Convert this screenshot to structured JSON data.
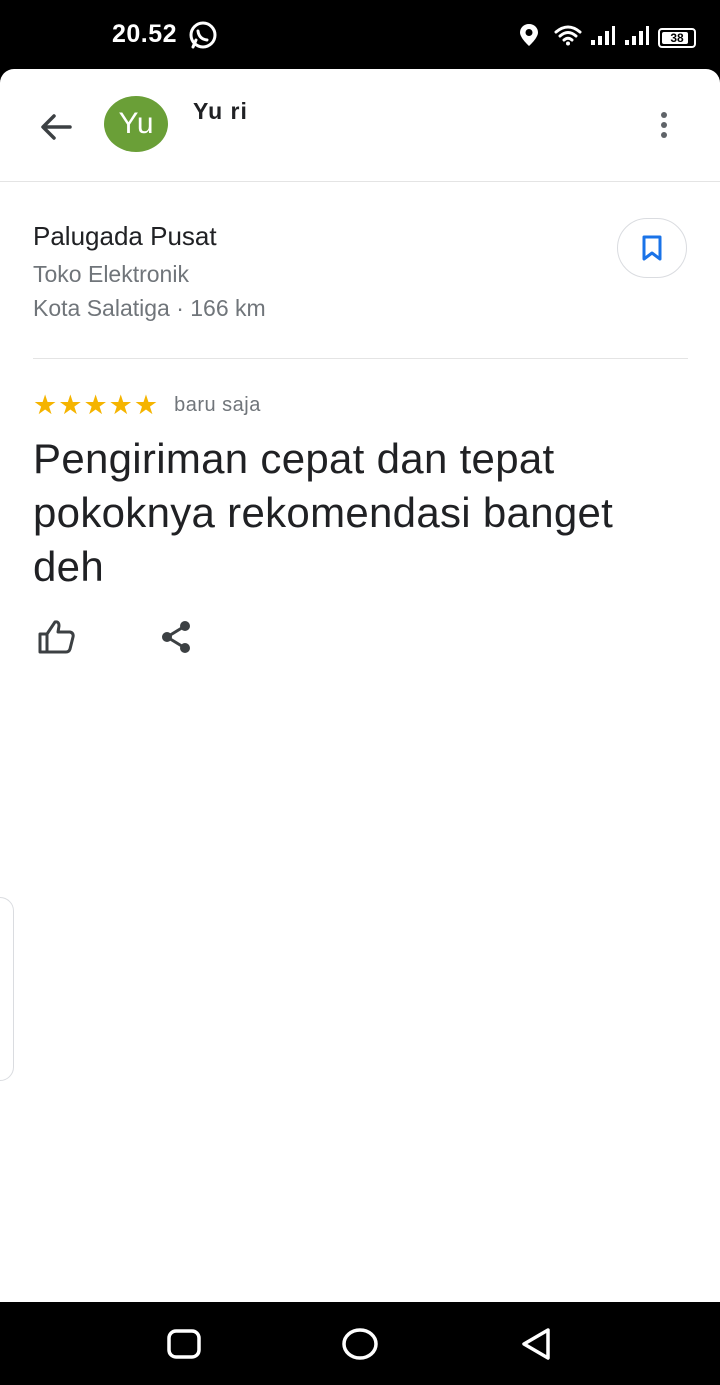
{
  "status_bar": {
    "time": "20.52",
    "battery": "38",
    "icons": [
      "whatsapp-icon",
      "location-icon",
      "wifi-icon",
      "signal-icon",
      "signal-icon",
      "battery-icon"
    ]
  },
  "header": {
    "avatar_initials": "Yu",
    "avatar_color": "#6a9f37",
    "user_name": "Yu ri"
  },
  "place": {
    "name": "Palugada Pusat",
    "category": "Toko Elektronik",
    "location": "Kota Salatiga · 166 km"
  },
  "review": {
    "rating": 5,
    "rating_max": 5,
    "time": "baru saja",
    "text": "Pengiriman cepat dan tepat pokoknya rekomendasi banget deh"
  },
  "colors": {
    "star": "#f5b400",
    "accent": "#1a73e8",
    "text_primary": "#202124",
    "text_secondary": "#70757a"
  },
  "nav_bar": {
    "buttons": [
      "recent-apps-button",
      "home-button",
      "back-nav-button"
    ]
  }
}
